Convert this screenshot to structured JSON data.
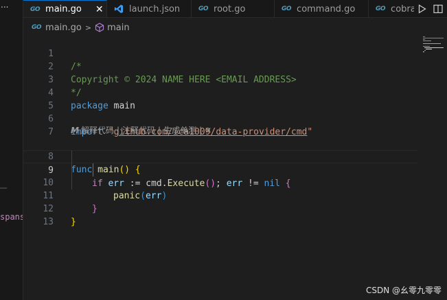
{
  "sidebar": {
    "ellipsis": "...",
    "partial_text": "spans"
  },
  "tabs": [
    {
      "label": "main.go",
      "icon": "go-icon",
      "active": true
    },
    {
      "label": "launch.json",
      "icon": "vscode-icon",
      "active": false
    },
    {
      "label": "root.go",
      "icon": "go-icon",
      "active": false
    },
    {
      "label": "command.go",
      "icon": "go-icon",
      "active": false
    },
    {
      "label": "cobra.",
      "icon": "go-icon",
      "active": false
    }
  ],
  "icons": {
    "go": "GO",
    "close": "✕"
  },
  "breadcrumb": {
    "file": "main.go",
    "separator": ">",
    "symbol": "main"
  },
  "editor": {
    "current_line": 9,
    "line_numbers": [
      "1",
      "2",
      "3",
      "4",
      "5",
      "6",
      "7",
      "8",
      "9",
      "10",
      "11",
      "12",
      "13"
    ],
    "lines": {
      "l1": "/*",
      "l2": "Copyright © 2024 NAME HERE <EMAIL ADDRESS>",
      "l3": "*/",
      "l4_kw": "package",
      "l4_name": " main",
      "l6_kw": "import",
      "l6_q1": " \"",
      "l6_path": "github.com/ica1009/data-provider/cmd",
      "l6_q2": "\"",
      "l8_kw": "func",
      "l8_fn": " main",
      "l8_paren": "()",
      "l8_brace": " {",
      "l9_kw": "if",
      "l9_var": " err",
      "l9_op": " := ",
      "l9_pkg": "cmd",
      "l9_dot": ".",
      "l9_fn": "Execute",
      "l9_paren": "()",
      "l9_semi": "; ",
      "l9_var2": "err",
      "l9_neq": " != ",
      "l9_nil": "nil",
      "l9_brace": " {",
      "l10_fn": "panic",
      "l10_open": "(",
      "l10_arg": "err",
      "l10_close": ")",
      "l11_brace": "}",
      "l12_brace": "}"
    },
    "codelens": {
      "logo": "M",
      "explain": "解释代码",
      "comment": "注释代码",
      "unittest": "生成单测",
      "pipe": "|",
      "close": "✕"
    }
  },
  "watermark": "CSDN @幺零九零零"
}
